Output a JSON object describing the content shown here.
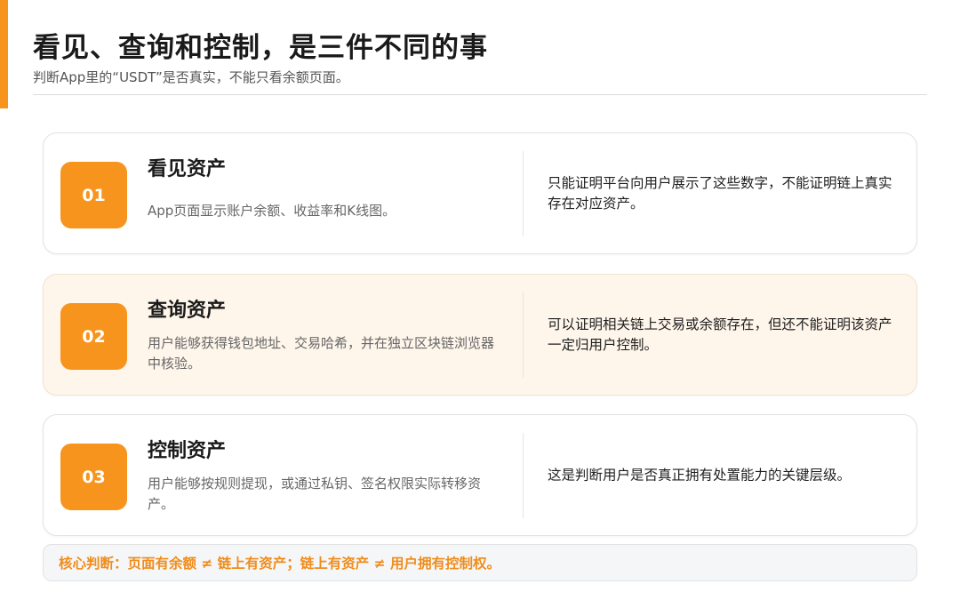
{
  "header": {
    "title": "看见、查询和控制，是三件不同的事",
    "subtitle": "判断App里的“USDT”是否真实，不能只看余额页面。",
    "accent_color": "#f7941d"
  },
  "cards": [
    {
      "number": "01",
      "title": "看见资产",
      "description": "App页面显示账户余额、收益率和K线图。",
      "note": "只能证明平台向用户展示了这些数字，不能证明链上真实存在对应资产。"
    },
    {
      "number": "02",
      "title": "查询资产",
      "description": "用户能够获得钱包地址、交易哈希，并在独立区块链浏览器中核验。",
      "note": "可以证明相关链上交易或余额存在，但还不能证明该资产一定归用户控制。"
    },
    {
      "number": "03",
      "title": "控制资产",
      "description": "用户能够按规则提现，或通过私钥、签名权限实际转移资产。",
      "note": "这是判断用户是否真正拥有处置能力的关键层级。"
    }
  ],
  "footer": {
    "text": "核心判断：页面有余额 ≠ 链上有资产；链上有资产 ≠ 用户拥有控制权。",
    "text_color": "#f08c1a"
  }
}
